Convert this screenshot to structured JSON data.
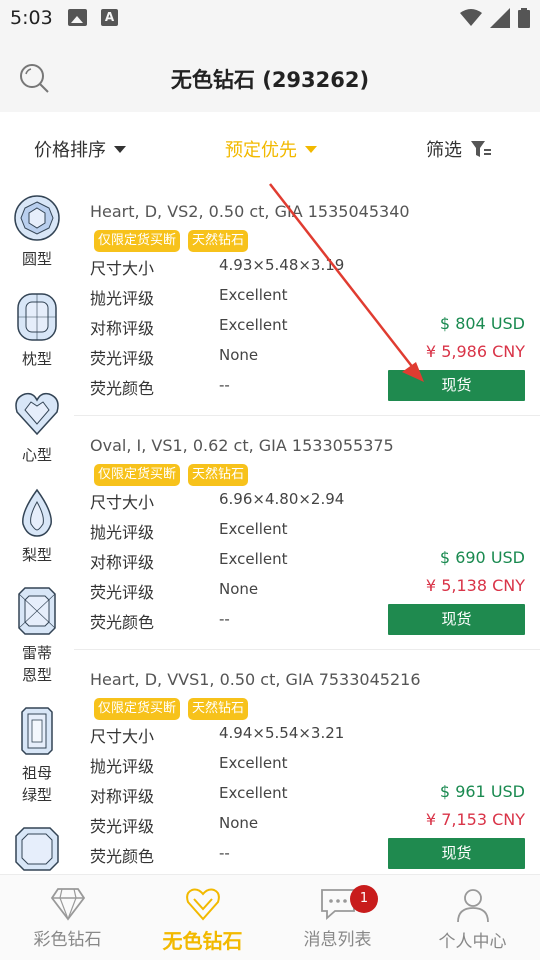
{
  "status_bar": {
    "time": "5:03",
    "icons": [
      "image-icon",
      "a-icon",
      "wifi-icon",
      "cell-signal-icon",
      "battery-icon"
    ]
  },
  "header": {
    "title": "无色钻石 (293262)",
    "search_icon": "search-icon"
  },
  "sort_bar": {
    "price_sort": "价格排序",
    "reserve_first": "预定优先",
    "filter": "筛选",
    "active_color": "#f2b900"
  },
  "shapes": [
    {
      "label": "圆型",
      "icon": "round-diamond-icon"
    },
    {
      "label": "枕型",
      "icon": "cushion-diamond-icon"
    },
    {
      "label": "心型",
      "icon": "heart-diamond-icon"
    },
    {
      "label": "梨型",
      "icon": "pear-diamond-icon"
    },
    {
      "label": "雷蒂恩型",
      "icon": "radiant-diamond-icon"
    },
    {
      "label": "祖母绿型",
      "icon": "emerald-diamond-icon"
    },
    {
      "label": "",
      "icon": "asscher-diamond-icon"
    }
  ],
  "spec_labels": {
    "size": "尺寸大小",
    "polish": "抛光评级",
    "symmetry": "对称评级",
    "fluorescence": "荧光评级",
    "fluor_color": "荧光颜色"
  },
  "products": [
    {
      "title": "Heart, D, VS2, 0.50 ct, GIA 1535045340",
      "tags": [
        "仅限定货买断",
        "天然钻石"
      ],
      "size": "4.93×5.48×3.19",
      "polish": "Excellent",
      "symmetry": "Excellent",
      "fluorescence": "None",
      "fluor_color": "--",
      "price_usd": "$ 804 USD",
      "price_cny": "¥ 5,986 CNY",
      "button": "现货"
    },
    {
      "title": "Oval, I, VS1, 0.62 ct, GIA 1533055375",
      "tags": [
        "仅限定货买断",
        "天然钻石"
      ],
      "size": "6.96×4.80×2.94",
      "polish": "Excellent",
      "symmetry": "Excellent",
      "fluorescence": "None",
      "fluor_color": "--",
      "price_usd": "$ 690 USD",
      "price_cny": "¥ 5,138 CNY",
      "button": "现货"
    },
    {
      "title": "Heart, D, VVS1, 0.50 ct, GIA 7533045216",
      "tags": [
        "仅限定货买断",
        "天然钻石"
      ],
      "size": "4.94×5.54×3.21",
      "polish": "Excellent",
      "symmetry": "Excellent",
      "fluorescence": "None",
      "fluor_color": "--",
      "price_usd": "$ 961 USD",
      "price_cny": "¥ 7,153 CNY",
      "button": "现货"
    }
  ],
  "bottom_nav": [
    {
      "label": "彩色钻石",
      "icon": "diamond-outline-icon"
    },
    {
      "label": "无色钻石",
      "icon": "diamond-heart-icon",
      "active": true
    },
    {
      "label": "消息列表",
      "icon": "chat-icon",
      "badge": "1"
    },
    {
      "label": "个人中心",
      "icon": "person-icon"
    }
  ],
  "colors": {
    "accent": "#f2b900",
    "stock_green": "#1f8a4f",
    "usd_green": "#1a8a50",
    "cny_red": "#d93448",
    "tag_yellow": "#f7c21b",
    "badge_red": "#c81c1c",
    "arrow_red": "#e03c31"
  }
}
